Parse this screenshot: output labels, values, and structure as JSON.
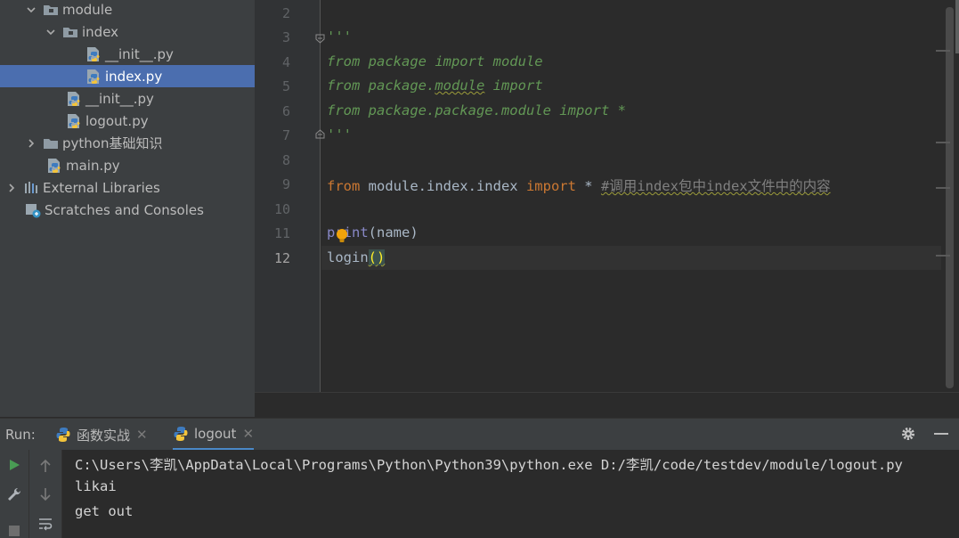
{
  "project_tree": {
    "items": [
      {
        "label": "module",
        "icon": "folder-icon",
        "expanded": true
      },
      {
        "label": "index",
        "icon": "folder-icon",
        "expanded": true
      },
      {
        "label": "__init__.py",
        "icon": "python-file-icon"
      },
      {
        "label": "index.py",
        "icon": "python-file-icon",
        "selected": true
      },
      {
        "label": "__init__.py",
        "icon": "python-file-icon"
      },
      {
        "label": "logout.py",
        "icon": "python-file-icon"
      },
      {
        "label": "python基础知识",
        "icon": "folder-icon",
        "expanded": false
      },
      {
        "label": "main.py",
        "icon": "python-file-icon"
      },
      {
        "label": "External Libraries",
        "icon": "libraries-icon",
        "expanded": false
      },
      {
        "label": "Scratches and Consoles",
        "icon": "scratches-icon"
      }
    ]
  },
  "editor": {
    "line_numbers": [
      "2",
      "3",
      "4",
      "5",
      "6",
      "7",
      "8",
      "9",
      "10",
      "11",
      "12"
    ],
    "current_line": "12",
    "code": {
      "l3": "'''",
      "l4_a": "from package import ",
      "l4_b": "module",
      "l5_a": "from package.",
      "l5_b": "module",
      "l5_c": " import",
      "l6": "from package.package.module import *",
      "l7": "'''",
      "l9_from": "from",
      "l9_mod": " module.index.index ",
      "l9_import": "import",
      "l9_star": " * ",
      "l9_comment": "#调用index包中index文件中的内容",
      "l11_a": "pr",
      "l11_b": "int",
      "l11_c": "(name)",
      "l12_a": "login",
      "l12_b": "()"
    }
  },
  "run_panel": {
    "label": "Run:",
    "tabs": [
      {
        "label": "函数实战",
        "icon": "python-icon",
        "active": false
      },
      {
        "label": "logout",
        "icon": "python-icon",
        "active": true
      }
    ],
    "output": [
      "C:\\Users\\李凯\\AppData\\Local\\Programs\\Python\\Python39\\python.exe D:/李凯/code/testdev/module/logout.py",
      "likai",
      "get out"
    ]
  },
  "colors": {
    "tree_bg": "#3c3f41",
    "selection": "#4b6eaf",
    "editor_bg": "#2b2b2b",
    "keyword": "#cc7832",
    "comment": "#629755",
    "builtin": "#8888c6"
  }
}
